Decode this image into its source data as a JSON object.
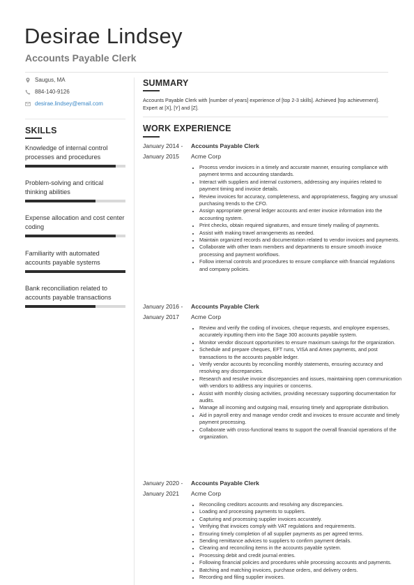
{
  "header": {
    "name": "Desirae Lindsey",
    "title": "Accounts Payable Clerk"
  },
  "contact": {
    "location": "Saugus, MA",
    "phone": "884-140-9126",
    "email": "desirae.lindsey@email.com",
    "icons": [
      "location-pin-icon",
      "phone-icon",
      "envelope-icon"
    ]
  },
  "skills": {
    "heading": "SKILLS",
    "items": [
      {
        "label": "Knowledge of internal control processes and procedures",
        "level_percent": 90
      },
      {
        "label": "Problem-solving and critical thinking abilities",
        "level_percent": 70
      },
      {
        "label": "Expense allocation and cost center coding",
        "level_percent": 90
      },
      {
        "label": "Familiarity with automated accounts payable systems",
        "level_percent": 100
      },
      {
        "label": "Bank reconciliation related to accounts payable transactions",
        "level_percent": 70
      }
    ]
  },
  "summary": {
    "heading": "SUMMARY",
    "text": "Accounts Payable Clerk with [number of years] experience of [top 2-3 skills]. Achieved [top achievement]. Expert at [X], [Y] and [Z]."
  },
  "work": {
    "heading": "WORK EXPERIENCE",
    "jobs": [
      {
        "date_start": "January 2014 -",
        "date_end": "January 2015",
        "title": "Accounts Payable Clerk",
        "company": "Acme Corp",
        "bullets": [
          "Process vendor invoices in a timely and accurate manner, ensuring compliance with payment terms and accounting standards.",
          "Interact with suppliers and internal customers, addressing any inquiries related to payment timing and invoice details.",
          "Review invoices for accuracy, completeness, and appropriateness, flagging any unusual purchasing trends to the CFO.",
          "Assign appropriate general ledger accounts and enter invoice information into the accounting system.",
          "Print checks, obtain required signatures, and ensure timely mailing of payments.",
          "Assist with making travel arrangements as needed.",
          "Maintain organized records and documentation related to vendor invoices and payments.",
          "Collaborate with other team members and departments to ensure smooth invoice processing and payment workflows.",
          "Follow internal controls and procedures to ensure compliance with financial regulations and company policies."
        ]
      },
      {
        "date_start": "January 2016 -",
        "date_end": "January 2017",
        "title": "Accounts Payable Clerk",
        "company": "Acme Corp",
        "bullets": [
          "Review and verify the coding of invoices, cheque requests, and employee expenses, accurately inputting them into the Sage 300 accounts payable system.",
          "Monitor vendor discount opportunities to ensure maximum savings for the organization.",
          "Schedule and prepare cheques, EFT runs, VISA and Amex payments, and post transactions to the accounts payable ledger.",
          "Verify vendor accounts by reconciling monthly statements, ensuring accuracy and resolving any discrepancies.",
          "Research and resolve invoice discrepancies and issues, maintaining open communication with vendors to address any inquiries or concerns.",
          "Assist with monthly closing activities, providing necessary supporting documentation for audits.",
          "Manage all incoming and outgoing mail, ensuring timely and appropriate distribution.",
          "Aid in payroll entry and manage vendor credit and invoices to ensure accurate and timely payment processing.",
          "Collaborate with cross-functional teams to support the overall financial operations of the organization."
        ]
      },
      {
        "date_start": "January 2020 -",
        "date_end": "January 2021",
        "title": "Accounts Payable Clerk",
        "company": "Acme Corp",
        "bullets": [
          "Reconciling creditors accounts and resolving any discrepancies.",
          "Loading and processing payments to suppliers.",
          "Capturing and processing supplier invoices accurately.",
          "Verifying that invoices comply with VAT regulations and requirements.",
          "Ensuring timely completion of all supplier payments as per agreed terms.",
          "Sending remittance advices to suppliers to confirm payment details.",
          "Clearing and reconciling items in the accounts payable system.",
          "Processing debit and credit journal entries.",
          "Following financial policies and procedures while processing accounts and payments.",
          "Batching and matching invoices, purchase orders, and delivery orders.",
          "Recording and filing supplier invoices."
        ]
      }
    ]
  }
}
